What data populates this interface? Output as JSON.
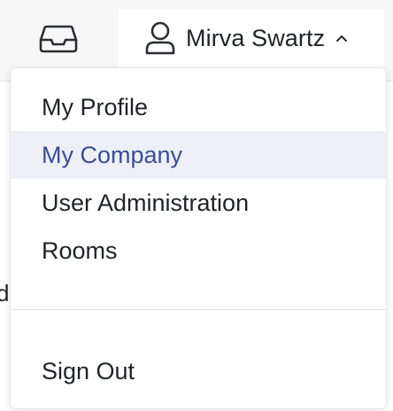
{
  "header": {
    "inbox_icon": "inbox-tray-icon",
    "user": {
      "icon": "user-icon",
      "name": "Mirva Swartz",
      "caret_icon": "chevron-up-icon"
    }
  },
  "background": {
    "partial_text": "d"
  },
  "menu": {
    "items": [
      {
        "label": "My Profile",
        "active": false
      },
      {
        "label": "My Company",
        "active": true
      },
      {
        "label": "User Administration",
        "active": false
      },
      {
        "label": "Rooms",
        "active": false
      }
    ],
    "sign_out": {
      "label": "Sign Out"
    }
  },
  "colors": {
    "active_item_bg": "#eef0f8",
    "active_item_text": "#3a4e95",
    "topbar_bg": "#f7f7f8"
  }
}
